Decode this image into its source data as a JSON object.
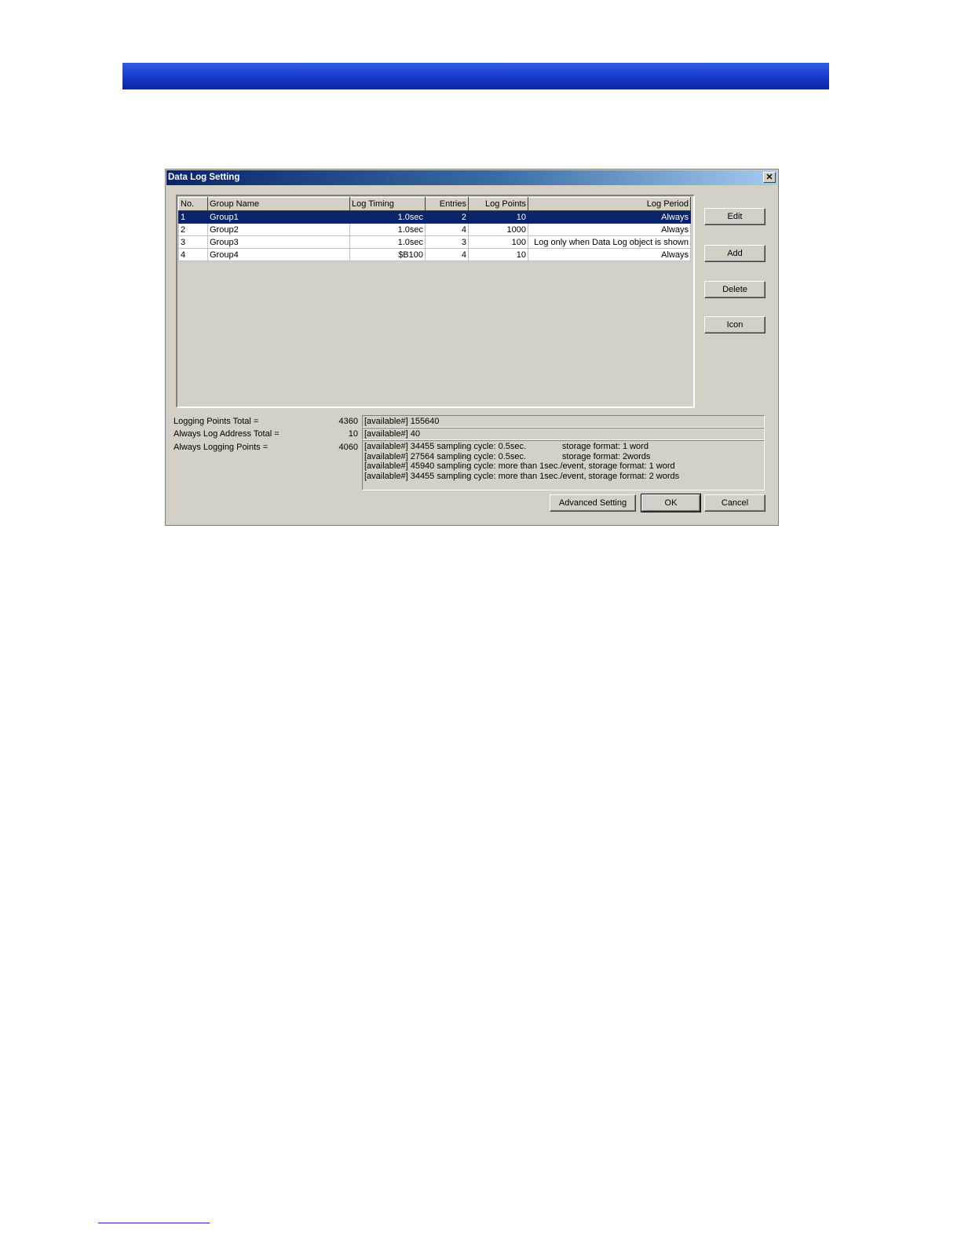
{
  "dialog": {
    "title": "Data Log Setting",
    "close_glyph": "✕"
  },
  "table": {
    "headers": [
      "No.",
      "Group Name",
      "Log Timing",
      "Entries",
      "Log Points",
      "Log Period"
    ],
    "rows": [
      [
        "1",
        "Group1",
        "1.0sec",
        "2",
        "10",
        "Always"
      ],
      [
        "2",
        "Group2",
        "1.0sec",
        "4",
        "1000",
        "Always"
      ],
      [
        "3",
        "Group3",
        "1.0sec",
        "3",
        "100",
        "Log only when Data Log object is shown"
      ],
      [
        "4",
        "Group4",
        "$B100",
        "4",
        "10",
        "Always"
      ]
    ],
    "selected_row": 0
  },
  "buttons": {
    "edit": "Edit",
    "add": "Add",
    "delete": "Delete",
    "icon": "Icon",
    "advanced": "Advanced Setting",
    "ok": "OK",
    "cancel": "Cancel"
  },
  "totals": {
    "logging_points_label": "Logging Points Total =",
    "logging_points_value": "4360",
    "always_log_address_label": "Always Log Address Total =",
    "always_log_address_value": "10",
    "always_logging_points_label": "Always Logging Points =",
    "always_logging_points_value": "4060"
  },
  "info": {
    "logging_points_available": "[available#] 155640",
    "address_available": "[available#] 40",
    "sampling_lines": [
      "[available#] 34455 sampling cycle: 0.5sec.               storage format: 1 word",
      "[available#] 27564 sampling cycle: 0.5sec.               storage format: 2words",
      "[available#] 45940 sampling cycle: more than 1sec./event, storage format: 1 word",
      "[available#] 34455 sampling cycle: more than 1sec./event, storage format: 2 words"
    ]
  }
}
